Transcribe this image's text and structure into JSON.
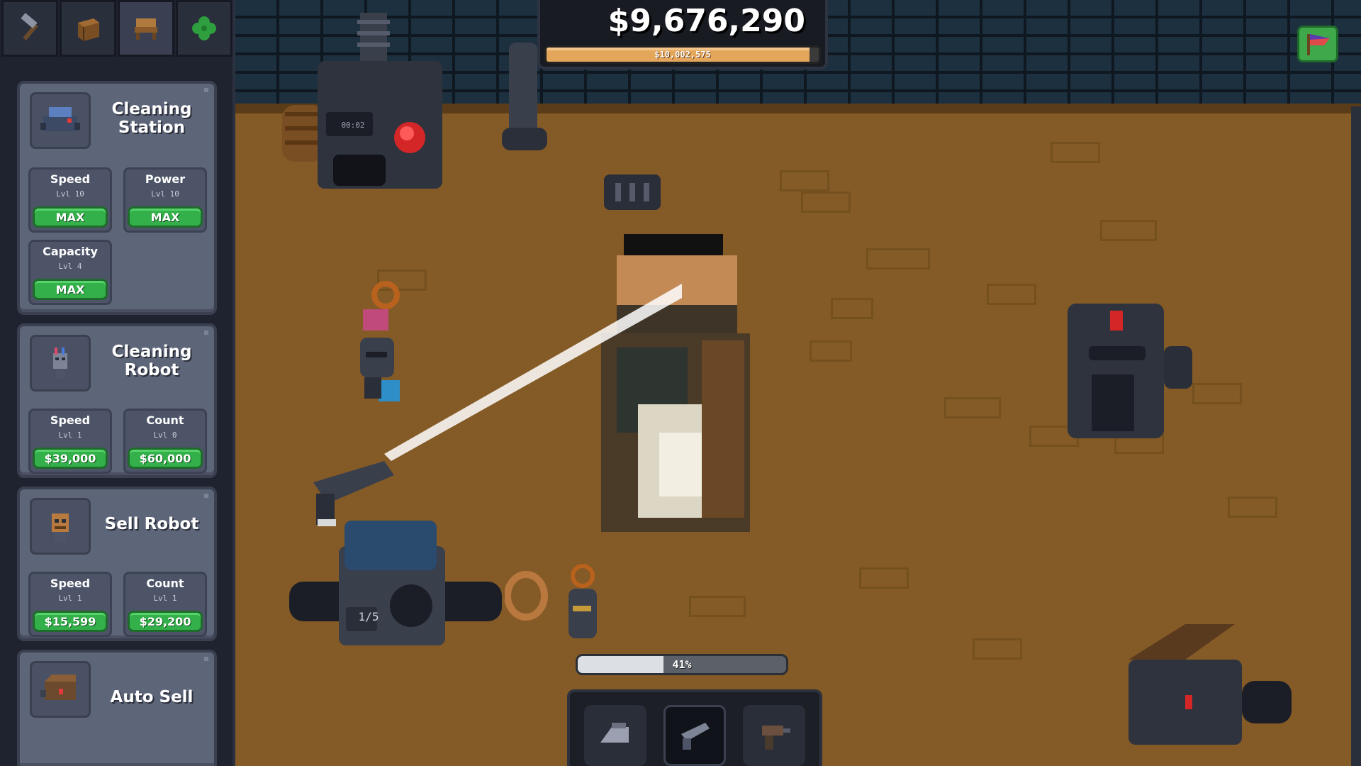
{
  "hud": {
    "money": "$9,676,290",
    "goal": "$10,002,575",
    "goal_progress": 0.967,
    "machine_timer": "00:02",
    "sell_robot_load": "1/5",
    "cleaning_progress": "41%",
    "cleaning_progress_value": 0.41
  },
  "tabs": [
    {
      "icon": "hammer-icon"
    },
    {
      "icon": "crate-icon"
    },
    {
      "icon": "bench-icon"
    },
    {
      "icon": "clover-icon"
    }
  ],
  "panels": {
    "cleaning_station": {
      "title": "Cleaning Station",
      "upgrades": [
        {
          "name": "Speed",
          "level": "Lvl 10",
          "button": "MAX"
        },
        {
          "name": "Power",
          "level": "Lvl 10",
          "button": "MAX"
        },
        {
          "name": "Capacity",
          "level": "Lvl 4",
          "button": "MAX"
        }
      ]
    },
    "cleaning_robot": {
      "title": "Cleaning Robot",
      "upgrades": [
        {
          "name": "Speed",
          "level": "Lvl 1",
          "button": "$39,000"
        },
        {
          "name": "Count",
          "level": "Lvl 0",
          "button": "$60,000"
        }
      ]
    },
    "sell_robot": {
      "title": "Sell Robot",
      "upgrades": [
        {
          "name": "Speed",
          "level": "Lvl 1",
          "button": "$15,599"
        },
        {
          "name": "Count",
          "level": "Lvl 1",
          "button": "$29,200"
        }
      ]
    },
    "auto_sell": {
      "title": "Auto Sell"
    }
  },
  "toolbar": [
    {
      "icon": "iron-tool-icon",
      "active": false
    },
    {
      "icon": "pressure-washer-icon",
      "active": true
    },
    {
      "icon": "drill-icon",
      "active": false
    }
  ],
  "colors": {
    "floor": "#845a26",
    "wall": "#1d3040",
    "button_green": "#33b04a",
    "panel": "#5d6578",
    "goal_fill": "#e3a65a"
  }
}
